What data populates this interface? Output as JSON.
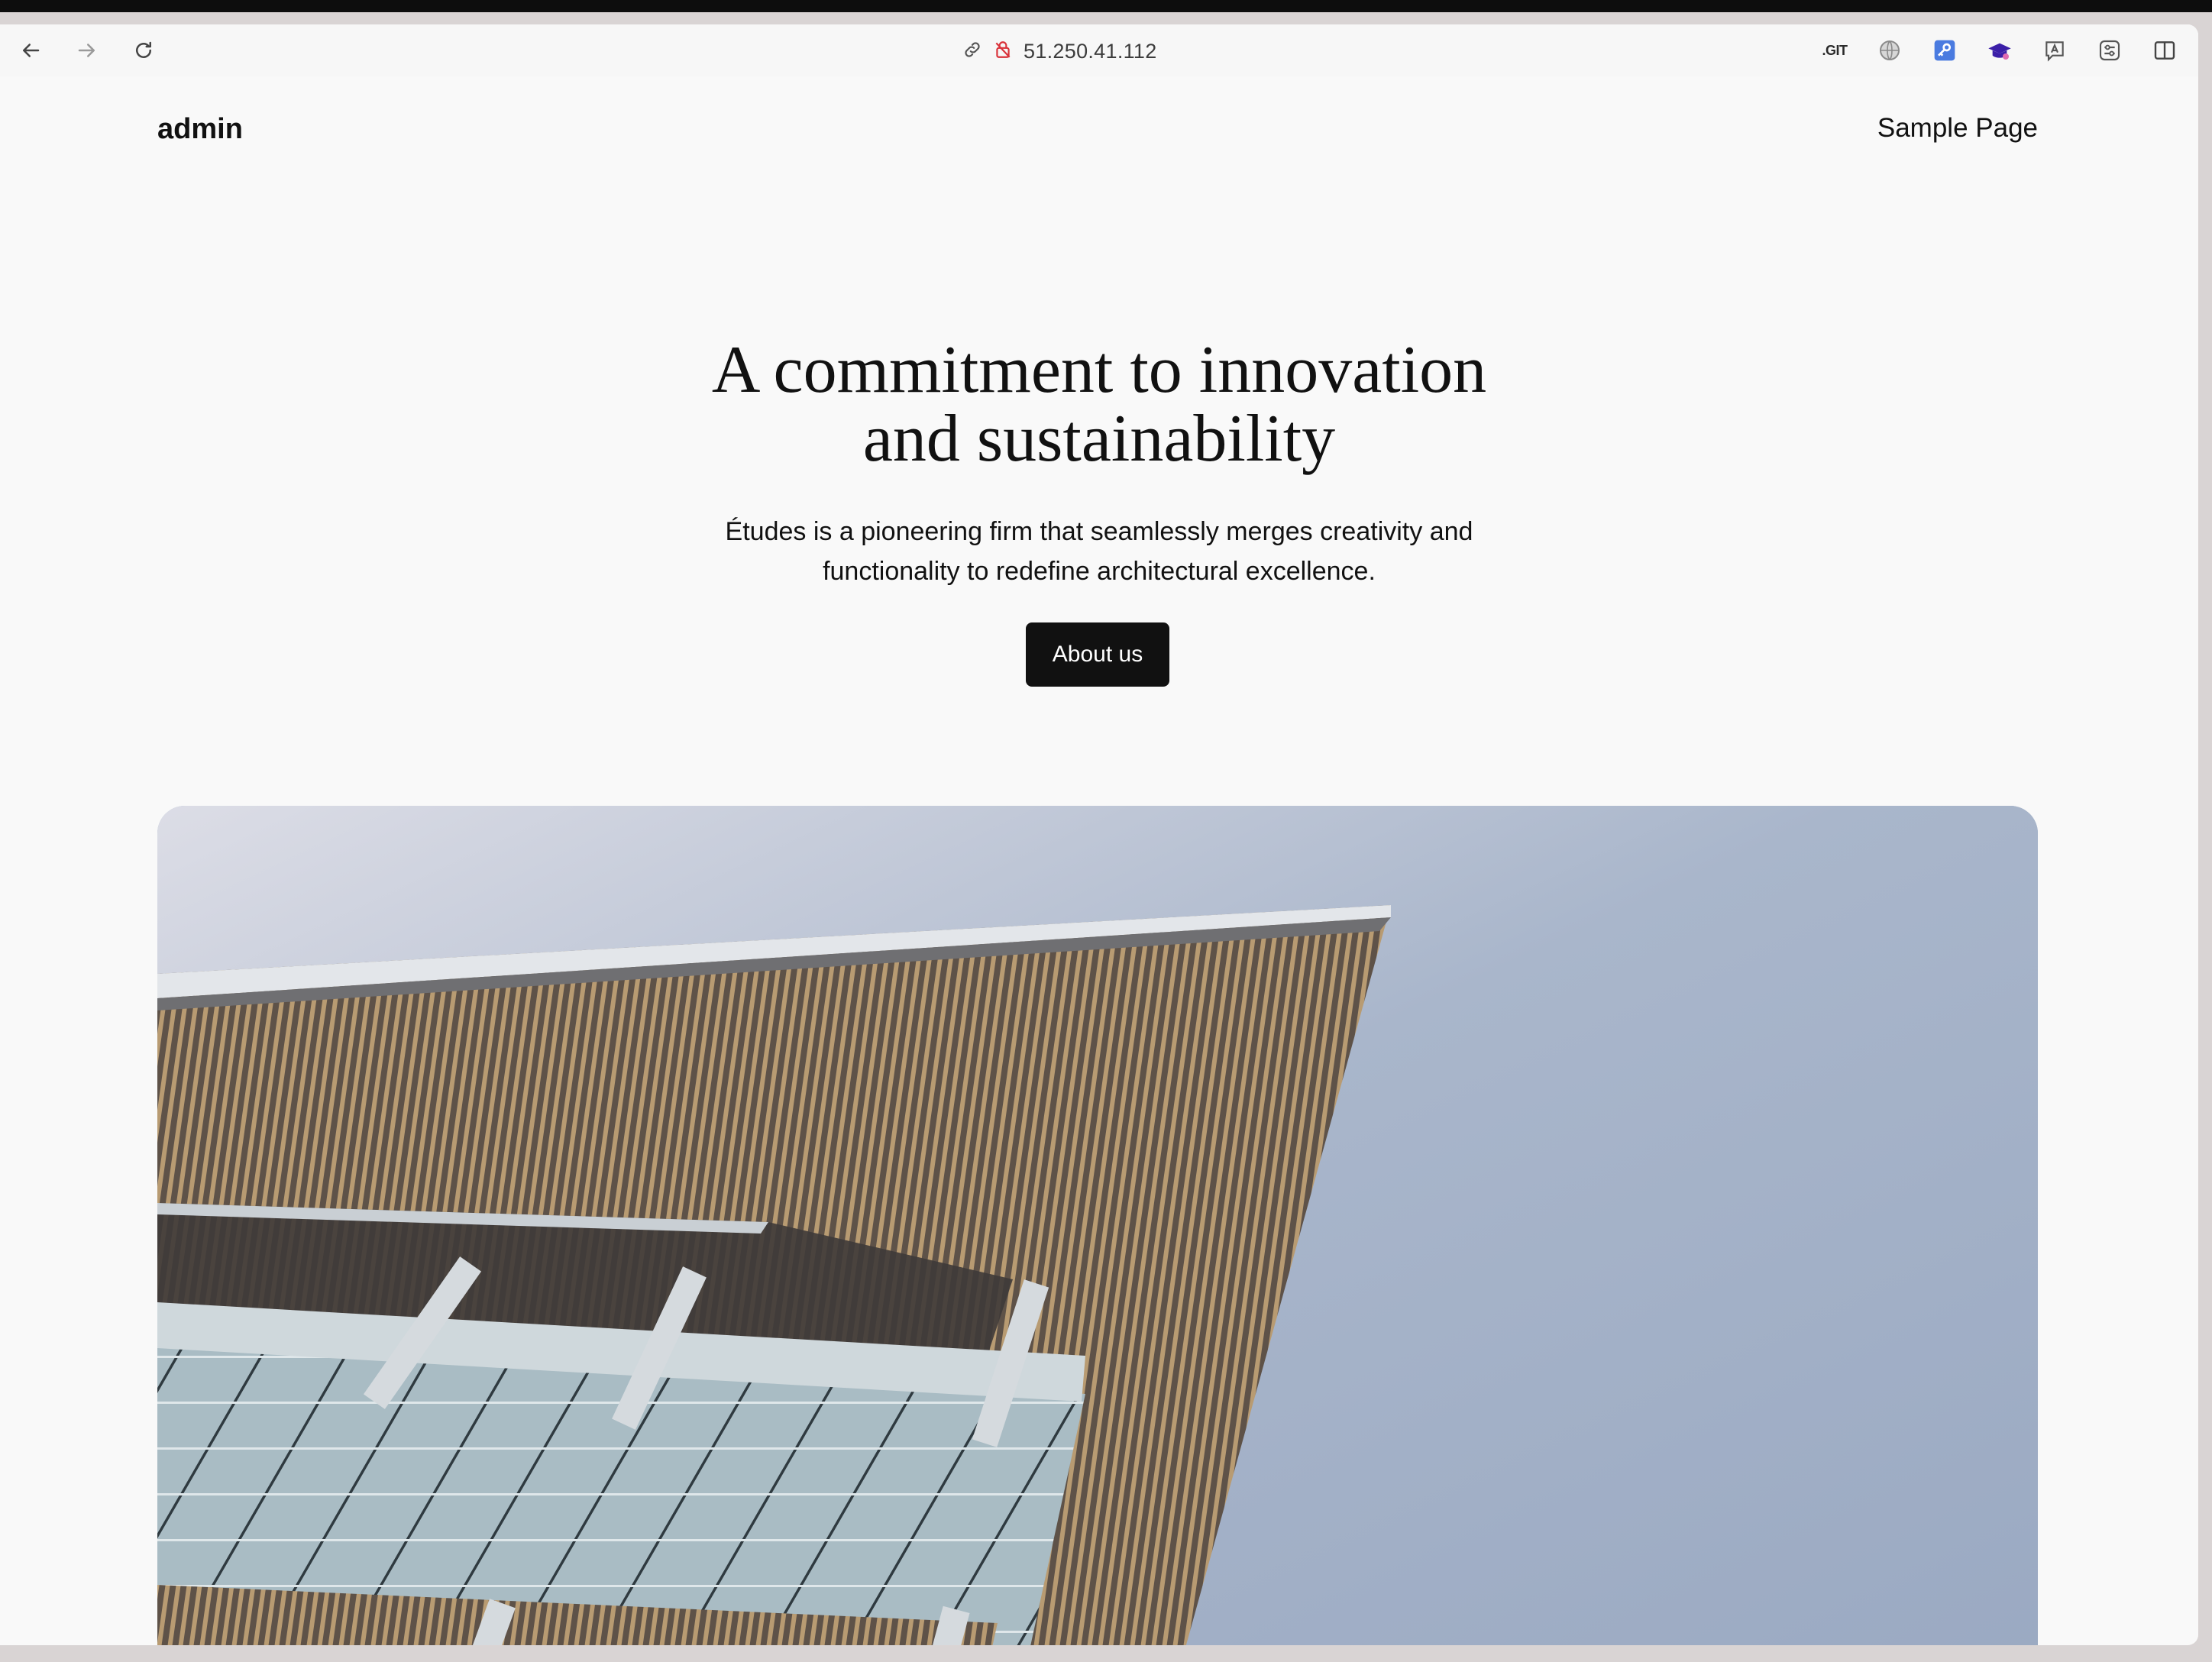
{
  "browser": {
    "url": "51.250.41.112",
    "toolbar_icons": [
      "back-arrow-icon",
      "forward-arrow-icon",
      "reload-icon",
      "link-icon",
      "insecure-lock-icon"
    ],
    "extensions": [
      {
        "name": "git-extension-icon",
        "label": ".GIT"
      },
      {
        "name": "globe-extension-icon"
      },
      {
        "name": "key-extension-icon",
        "color": "#4a7be0"
      },
      {
        "name": "mortarboard-extension-icon",
        "color": "#3b1fa8"
      },
      {
        "name": "translate-extension-icon"
      },
      {
        "name": "sliders-extension-icon"
      },
      {
        "name": "sidebar-toggle-icon"
      }
    ]
  },
  "site": {
    "brand": "admin",
    "nav": {
      "sample_page": "Sample Page"
    },
    "hero": {
      "title_line1": "A commitment to innovation",
      "title_line2": "and sustainability",
      "subtitle_line1": "Études is a pioneering firm that seamlessly merges creativity and",
      "subtitle_line2": "functionality to redefine architectural excellence.",
      "cta": "About us"
    },
    "image": {
      "subject": "building-roof-photo"
    }
  },
  "colors": {
    "page_bg": "#f9f9f9",
    "text": "#111111",
    "button_bg": "#111111",
    "button_text": "#ffffff"
  }
}
